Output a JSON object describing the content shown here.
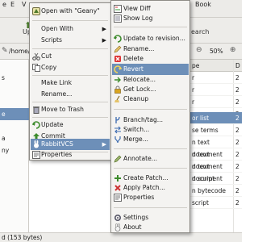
{
  "background": {
    "menubar": {
      "file_frag": "e",
      "edit_frag": "E",
      "view_frag": "V",
      "go_frag": "Go",
      "book_frag": "Book"
    },
    "toolbar": {
      "up_frag": "Up",
      "search_frag": "earch",
      "zoom": "50%"
    },
    "path_frag": "/home/bru",
    "left_rows": [
      "s",
      "e",
      "a",
      "ny"
    ],
    "list_header": {
      "c1": "pe",
      "c2": "D"
    },
    "list_rows": [
      {
        "c1": "r",
        "c2": "2"
      },
      {
        "c1": "r",
        "c2": "2"
      },
      {
        "c1": "r",
        "c2": "2"
      },
      {
        "c1": "r",
        "c2": "2"
      },
      {
        "c1": "or list",
        "c2": "2"
      },
      {
        "c1": "se terms",
        "c2": "2"
      },
      {
        "c1": "n text document",
        "c2": "2"
      },
      {
        "c1": "n text document",
        "c2": "2"
      },
      {
        "c1": "n text document",
        "c2": "2"
      },
      {
        "c1": "n script",
        "c2": "2"
      },
      {
        "c1": "n bytecode",
        "c2": "2"
      },
      {
        "c1": "script",
        "c2": "2"
      }
    ],
    "status": "d (153 bytes)",
    "colors": {
      "selection": "#6d8fb8",
      "menu_bg": "#f4f3f1"
    }
  },
  "menu_main": {
    "items": [
      {
        "label": "Open with \"Geany\"",
        "icon": "geany-icon"
      },
      {
        "label": "Open With",
        "icon": "",
        "arrow": "▶"
      },
      {
        "label": "Scripts",
        "icon": "",
        "arrow": "▶"
      },
      {
        "label": "Cut",
        "icon": "cut-icon"
      },
      {
        "label": "Copy",
        "icon": "copy-icon"
      },
      {
        "label": "Make Link",
        "icon": ""
      },
      {
        "label": "Rename...",
        "icon": ""
      },
      {
        "label": "Move to Trash",
        "icon": "trash-icon"
      },
      {
        "label": "Update",
        "icon": "update-icon"
      },
      {
        "label": "Commit",
        "icon": "commit-icon"
      },
      {
        "label": "RabbitVCS",
        "icon": "rabbitvcs-icon",
        "arrow": "▶"
      },
      {
        "label": "Properties",
        "icon": "properties-icon"
      }
    ]
  },
  "menu_rabbitvcs": {
    "items": [
      {
        "label": "View Diff",
        "icon": "diff-icon"
      },
      {
        "label": "Show Log",
        "icon": "log-icon"
      },
      {
        "label": "Update to revision...",
        "icon": "update-icon"
      },
      {
        "label": "Rename...",
        "icon": "rename-icon"
      },
      {
        "label": "Delete",
        "icon": "delete-icon"
      },
      {
        "label": "Revert",
        "icon": "revert-icon"
      },
      {
        "label": "Relocate...",
        "icon": "relocate-icon"
      },
      {
        "label": "Get Lock...",
        "icon": "lock-icon"
      },
      {
        "label": "Cleanup",
        "icon": "cleanup-icon"
      },
      {
        "label": "Branch/tag...",
        "icon": "branch-icon"
      },
      {
        "label": "Switch...",
        "icon": "switch-icon"
      },
      {
        "label": "Merge...",
        "icon": "merge-icon"
      },
      {
        "label": "Annotate...",
        "icon": "annotate-icon"
      },
      {
        "label": "Create Patch...",
        "icon": "create-patch-icon"
      },
      {
        "label": "Apply Patch...",
        "icon": "apply-patch-icon"
      },
      {
        "label": "Properties",
        "icon": "properties-icon"
      },
      {
        "label": "Settings",
        "icon": "settings-icon"
      },
      {
        "label": "About",
        "icon": "about-icon"
      }
    ]
  }
}
